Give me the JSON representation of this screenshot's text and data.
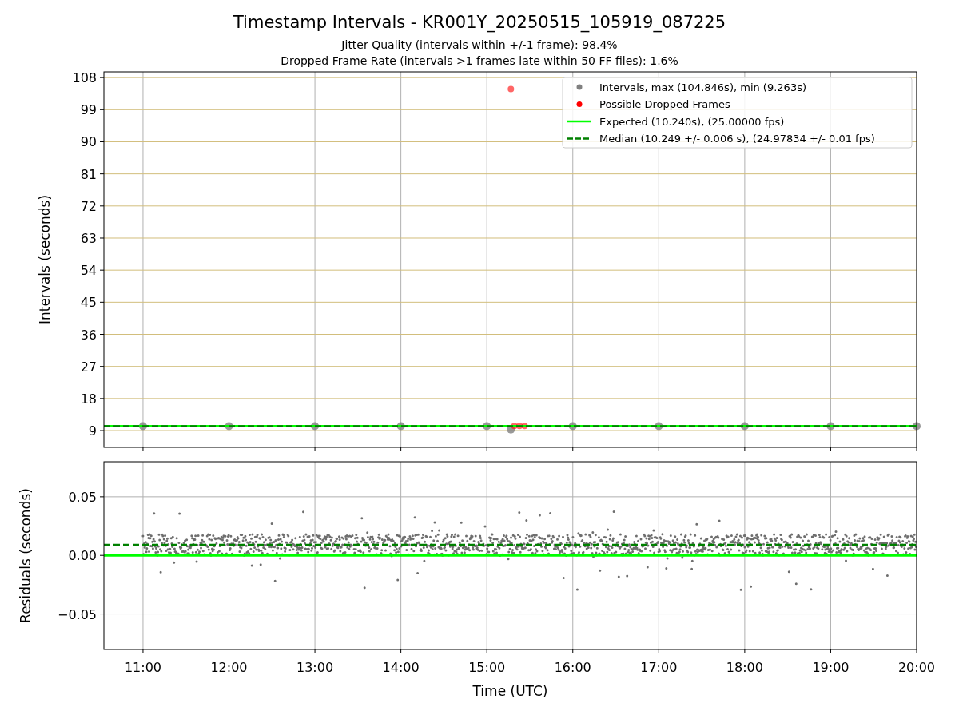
{
  "title": "Timestamp Intervals - KR001Y_20250515_105919_087225",
  "subtitle_lines": [
    "Jitter Quality (intervals within +/-1 frame): 98.4%",
    "Dropped Frame Rate (intervals >1 frames late within 50 FF files): 1.6%"
  ],
  "intervals_chart": {
    "chart_data": {
      "type": "scatter",
      "ylabel": "Intervals (seconds)",
      "grid": true,
      "legend": "upper right",
      "x": [
        10.545,
        11,
        12,
        13,
        14,
        15,
        15.28,
        15.32,
        15.38,
        15.44,
        16,
        17,
        18,
        19,
        20
      ],
      "xlim": [
        10.545,
        20
      ],
      "ylim": [
        4.3,
        109.6
      ],
      "yticks": [
        {
          "value": 9,
          "label": "9"
        },
        {
          "value": 18,
          "label": "18"
        },
        {
          "value": 27,
          "label": "27"
        },
        {
          "value": 36,
          "label": "36"
        },
        {
          "value": 45,
          "label": "45"
        },
        {
          "value": 54,
          "label": "54"
        },
        {
          "value": 63,
          "label": "63"
        },
        {
          "value": 72,
          "label": "72"
        },
        {
          "value": 81,
          "label": "81"
        },
        {
          "value": 90,
          "label": "90"
        },
        {
          "value": 99,
          "label": "99"
        },
        {
          "value": 108,
          "label": "108"
        }
      ],
      "series": [
        {
          "name": "Intervals, max (104.846s), min (9.263s)",
          "color": "#808080",
          "values": [
            null,
            10.24,
            10.24,
            10.24,
            10.24,
            10.24,
            9.3,
            null,
            null,
            null,
            10.24,
            10.24,
            10.24,
            10.24,
            10.24
          ]
        },
        {
          "name": "Possible Dropped Frames",
          "color": "#ff0000",
          "values": [
            null,
            null,
            null,
            null,
            null,
            null,
            104.8,
            10.3,
            10.3,
            10.3,
            null,
            null,
            null,
            null,
            null
          ]
        },
        {
          "name": "Expected (10.240s), (25.00000 fps)",
          "type": "line",
          "color": "#00ff00",
          "line_style": "solid",
          "values": [
            10.24,
            10.24,
            10.24,
            10.24,
            10.24,
            10.24,
            10.24,
            10.24,
            10.24,
            10.24,
            10.24,
            10.24,
            10.24,
            10.24,
            10.24
          ]
        },
        {
          "name": "Median (10.249 +/- 0.006 s), (24.97834 +/- 0.01 fps)",
          "type": "line",
          "color": "#008000",
          "line_style": "dashed",
          "values": [
            10.25,
            10.25,
            10.25,
            10.25,
            10.25,
            10.25,
            10.25,
            10.25,
            10.25,
            10.25,
            10.25,
            10.25,
            10.25,
            10.25,
            10.25
          ]
        }
      ]
    }
  },
  "residuals_chart": {
    "chart_data": {
      "type": "scatter",
      "xlabel": "Time (UTC)",
      "ylabel": "Residuals (seconds)",
      "grid": true,
      "x": [
        10.545,
        20
      ],
      "xlim": [
        10.545,
        20
      ],
      "ylim": [
        -0.0803,
        0.0799
      ],
      "xticks": [
        {
          "value": 11,
          "label": "11:00"
        },
        {
          "value": 12,
          "label": "12:00"
        },
        {
          "value": 13,
          "label": "13:00"
        },
        {
          "value": 14,
          "label": "14:00"
        },
        {
          "value": 15,
          "label": "15:00"
        },
        {
          "value": 16,
          "label": "16:00"
        },
        {
          "value": 17,
          "label": "17:00"
        },
        {
          "value": 18,
          "label": "18:00"
        },
        {
          "value": 19,
          "label": "19:00"
        },
        {
          "value": 20,
          "label": "20:00"
        }
      ],
      "yticks": [
        {
          "value": 0.05,
          "label": "0.05"
        },
        {
          "value": 0,
          "label": "0.00"
        },
        {
          "value": -0.05,
          "label": "−0.05"
        }
      ],
      "series": [
        {
          "type": "line",
          "color": "#00ff00",
          "line_style": "solid",
          "values": [
            0,
            0
          ]
        },
        {
          "type": "line",
          "color": "#008000",
          "line_style": "dashed",
          "values": [
            0.009,
            0.009
          ]
        }
      ]
    }
  }
}
